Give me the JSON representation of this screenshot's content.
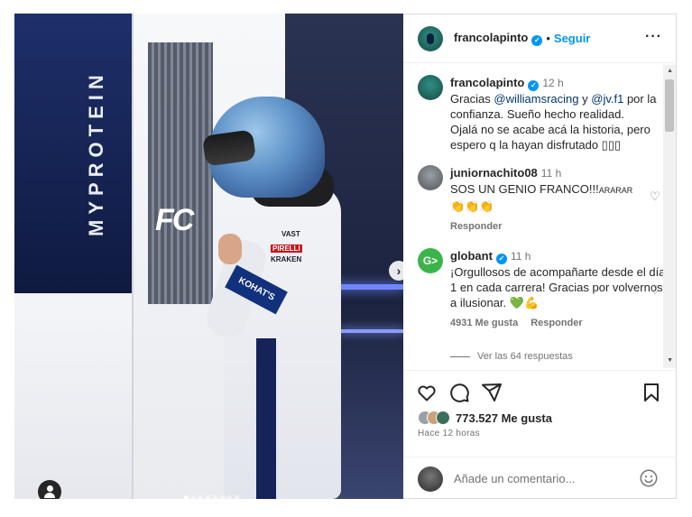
{
  "post": {
    "username": "francolapinto",
    "follow_label": "Seguir",
    "more_label": "···",
    "bullet": "•"
  },
  "photo": {
    "panel_text": "MYPROTEIN",
    "fc_logo": "FC",
    "arm_band": "KOHAT'S",
    "suit_logos": [
      "VAST",
      "PIRELLI",
      "KRAKEN"
    ],
    "carousel_dots": 8,
    "active_dot": 0
  },
  "comments": [
    {
      "username": "francolapinto",
      "time": "12 h",
      "text_pre": "Gracias ",
      "mention1": "@williamsracing",
      "text_mid": " y ",
      "mention2": "@jv.f1",
      "text_post": " por la confianza. Sueño hecho realidad.",
      "text_line2": "Ojalá no se acabe acá la historia, pero espero q la hayan disfrutado ",
      "emoji": "▯▯▯"
    },
    {
      "username": "juniornachito08",
      "time": "11 h",
      "text": "SOS UN GENIO FRANCO!!!",
      "text_small": "ARARAR",
      "emoji": "👏👏👏",
      "reply_label": "Responder"
    },
    {
      "username": "globant",
      "time": "11 h",
      "avatar_letter": "G>",
      "text": "¡Orgullosos de acompañarte desde el día 1 en cada carrera! Gracias por volvernos a ilusionar. ",
      "emoji": "💚💪",
      "likes_label": "4931 Me gusta",
      "reply_label": "Responder",
      "view_replies": "Ver las 64 respuestas"
    }
  ],
  "actions": {
    "likes": "773.527 Me gusta",
    "posted": "Hace 12 horas",
    "comment_placeholder": "Añade un comentario..."
  },
  "colors": {
    "accent": "#0095f6",
    "verified": "#0095f6",
    "globant": "#3bb54a",
    "text": "#262626",
    "muted": "#737373"
  }
}
